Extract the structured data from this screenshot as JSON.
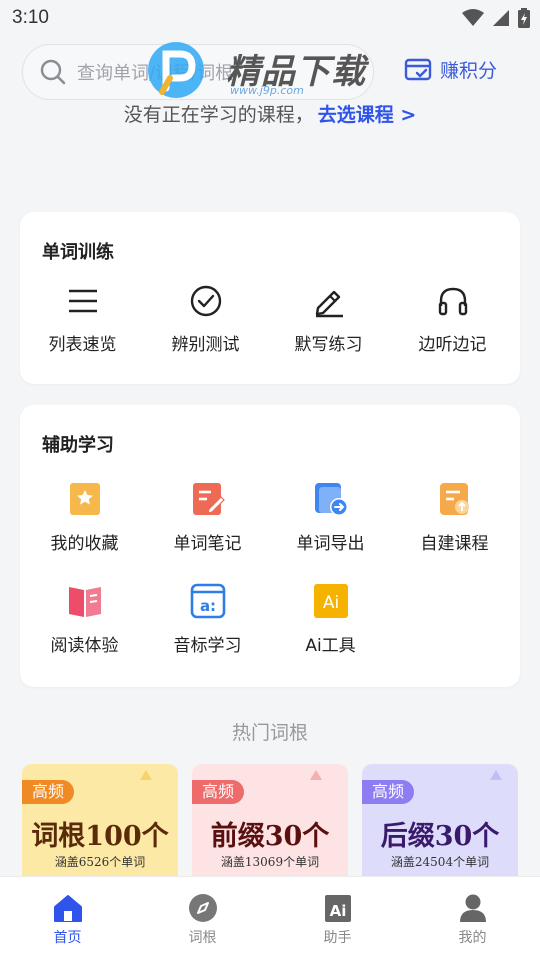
{
  "status": {
    "time": "3:10"
  },
  "search": {
    "placeholder": "查询单词/课程/词根"
  },
  "earn_points": {
    "label": "赚积分"
  },
  "watermark": {
    "text": "精品下载",
    "url": "www.j9p.com"
  },
  "no_course": {
    "text": "没有正在学习的课程，",
    "link": "去选课程 >"
  },
  "word_training": {
    "title": "单词训练",
    "items": [
      {
        "label": "列表速览",
        "icon": "list-icon"
      },
      {
        "label": "辨别测试",
        "icon": "check-circle-icon"
      },
      {
        "label": "默写练习",
        "icon": "pencil-icon"
      },
      {
        "label": "边听边记",
        "icon": "headphones-icon"
      }
    ]
  },
  "aux_learning": {
    "title": "辅助学习",
    "items": [
      {
        "label": "我的收藏",
        "icon": "star-bookmark-icon"
      },
      {
        "label": "单词笔记",
        "icon": "note-icon"
      },
      {
        "label": "单词导出",
        "icon": "export-icon"
      },
      {
        "label": "自建课程",
        "icon": "custom-course-icon"
      },
      {
        "label": "阅读体验",
        "icon": "book-icon"
      },
      {
        "label": "音标学习",
        "icon": "phonetic-icon"
      },
      {
        "label": "Ai工具",
        "icon": "ai-icon"
      }
    ]
  },
  "hot_roots": {
    "title": "热门词根",
    "cards": [
      {
        "badge": "高频",
        "title": "词根100个",
        "subtitle": "涵盖6526个单词",
        "bg": "#fde9a6",
        "badge_color": "#f08a24",
        "title_color": "#5a2a0a"
      },
      {
        "badge": "高频",
        "title": "前缀30个",
        "subtitle": "涵盖13069个单词",
        "bg": "#fde3e3",
        "badge_color": "#ee6b6b",
        "title_color": "#5a1010"
      },
      {
        "badge": "高频",
        "title": "后缀30个",
        "subtitle": "涵盖24504个单词",
        "bg": "#dedcfb",
        "badge_color": "#8e7cf2",
        "title_color": "#3a1a6a"
      }
    ]
  },
  "tabbar": {
    "tabs": [
      {
        "label": "首页",
        "icon": "home-icon",
        "active": true
      },
      {
        "label": "词根",
        "icon": "compass-icon",
        "active": false
      },
      {
        "label": "助手",
        "icon": "ai-assistant-icon",
        "active": false
      },
      {
        "label": "我的",
        "icon": "profile-icon",
        "active": false
      }
    ]
  },
  "colors": {
    "accent": "#2f54eb",
    "background": "#f4f5f7"
  }
}
